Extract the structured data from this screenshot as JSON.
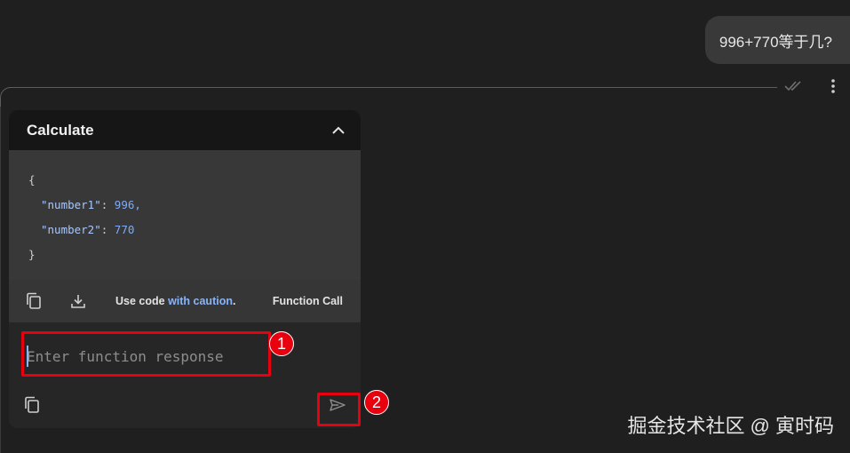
{
  "user_message": {
    "text": "996+770等于几?"
  },
  "model_turn": {
    "icons": {
      "read_receipt": "double-check-icon",
      "more": "more-vert-icon"
    }
  },
  "function_card": {
    "title": "Calculate",
    "collapse_icon": "chevron-up-icon",
    "code_lines": {
      "open": "{",
      "key1": "\"number1\"",
      "val1": "996,",
      "key2": "\"number2\"",
      "val2": "770",
      "close": "}"
    },
    "footer": {
      "caution_prefix": "Use code ",
      "caution_link": "with caution",
      "caution_suffix": ".",
      "label": "Function Call",
      "copy_icon": "copy-icon",
      "download_icon": "download-icon"
    },
    "response": {
      "placeholder": "Enter function response",
      "value": "",
      "send_icon": "send-icon",
      "copy_icon": "copy-icon"
    }
  },
  "annotations": [
    {
      "label": "1"
    },
    {
      "label": "2"
    }
  ],
  "colors": {
    "annotation": "#e8000f",
    "link": "#8ab4f8",
    "background": "#1f1f1f"
  },
  "watermark": {
    "text": "掘金技术社区 @ 寅时码"
  }
}
